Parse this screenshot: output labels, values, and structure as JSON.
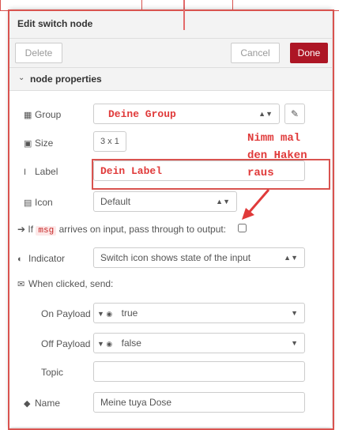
{
  "header": {
    "title": "Edit switch node"
  },
  "toolbar": {
    "delete_label": "Delete",
    "cancel_label": "Cancel",
    "done_label": "Done"
  },
  "section": {
    "label": "node properties"
  },
  "fields": {
    "group": {
      "label": "Group",
      "value": "Deine Group"
    },
    "size": {
      "label": "Size",
      "value": "3 x 1"
    },
    "label": {
      "label": "Label",
      "value": "Dein Label"
    },
    "icon": {
      "label": "Icon",
      "value": "Default"
    },
    "passthrough": {
      "prefix": "If",
      "code": "msg",
      "suffix": "arrives on input, pass through to output:"
    },
    "indicator": {
      "label": "Indicator",
      "value": "Switch icon shows state of the input"
    },
    "when_clicked": {
      "label": "When clicked, send:"
    },
    "on_payload": {
      "label": "On Payload",
      "value": "true"
    },
    "off_payload": {
      "label": "Off Payload",
      "value": "false"
    },
    "topic": {
      "label": "Topic",
      "value": ""
    },
    "name": {
      "label": "Name",
      "value": "Meine tuya Dose"
    }
  },
  "annotation": {
    "line1": "Nimm mal",
    "line2": "den Haken",
    "line3": "raus"
  },
  "accent_color": "#ad1625",
  "annotation_color": "#e03a3a"
}
